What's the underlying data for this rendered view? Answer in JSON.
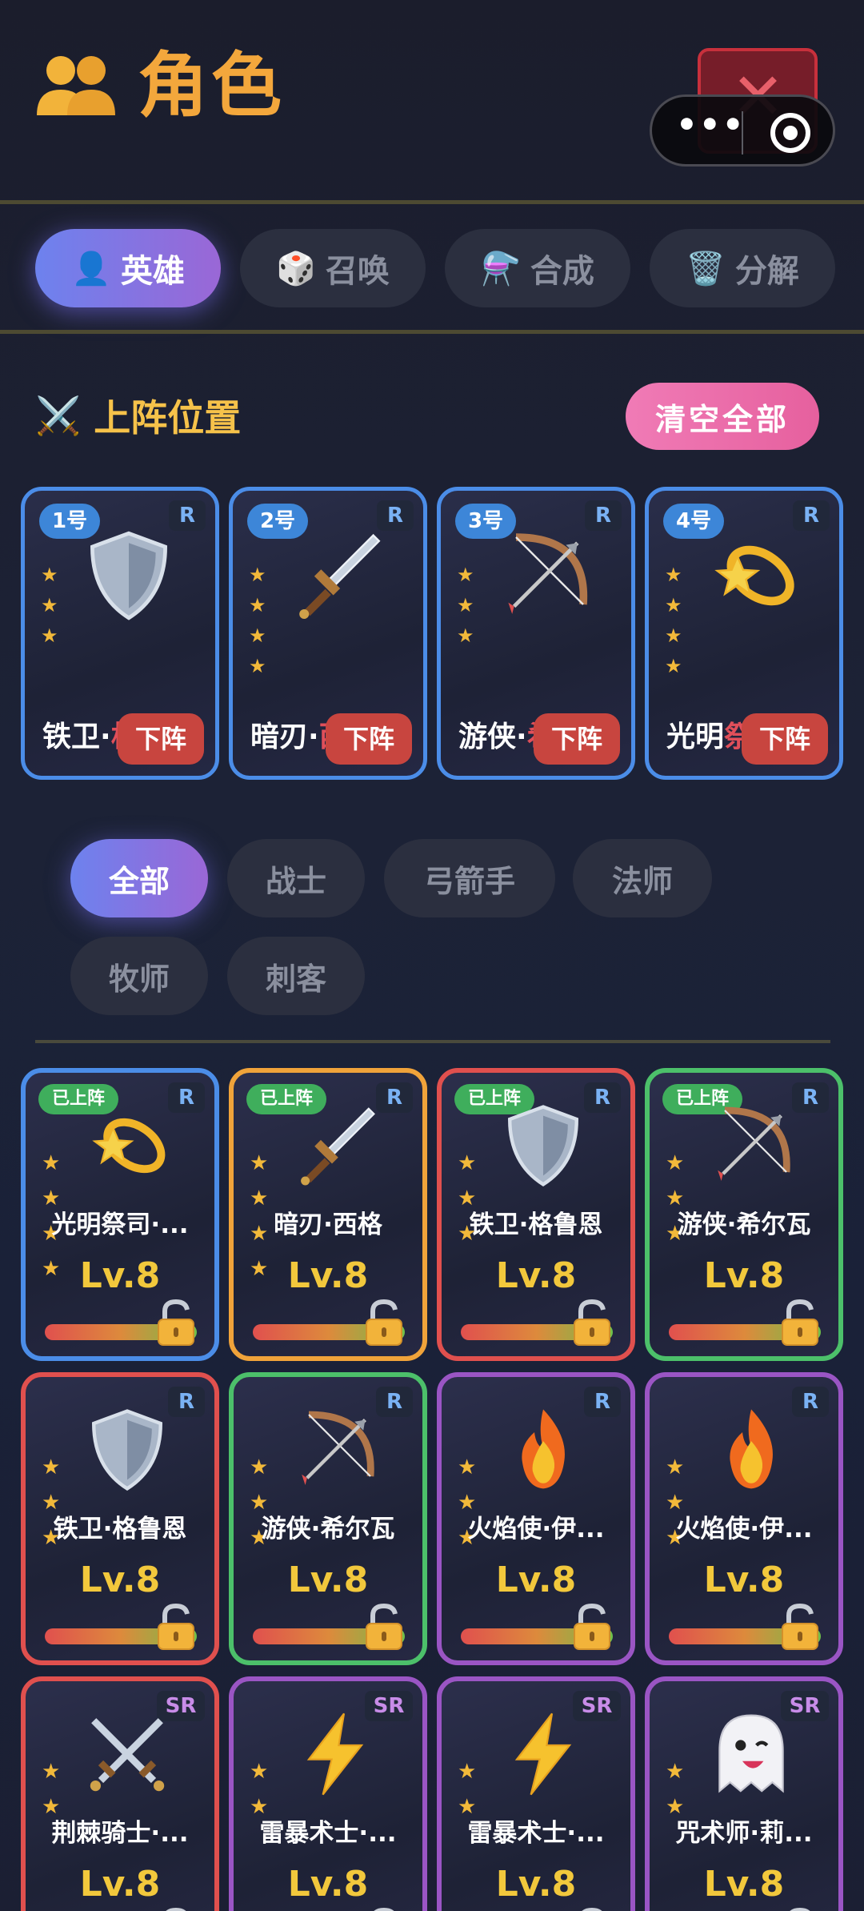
{
  "header": {
    "title": "角色",
    "title_icon": "👥"
  },
  "tabs": [
    {
      "icon": "👤",
      "label": "英雄"
    },
    {
      "icon": "🎲",
      "label": "召唤"
    },
    {
      "icon": "⚗️",
      "label": "合成"
    },
    {
      "icon": "🗑️",
      "label": "分解"
    }
  ],
  "lineup": {
    "icon": "⚔️",
    "title": "上阵位置",
    "clear_label": "清空全部",
    "slots": [
      {
        "num": "1号",
        "rarity": "R",
        "emoji": "🛡️",
        "name": "铁卫·",
        "name_fade": "格",
        "action": "下阵",
        "stars": [
          "★",
          "★",
          "★"
        ]
      },
      {
        "num": "2号",
        "rarity": "R",
        "emoji": "🗡️",
        "name": "暗刃·",
        "name_fade": "西格",
        "action": "下阵",
        "stars": [
          "★",
          "★",
          "★",
          "★"
        ]
      },
      {
        "num": "3号",
        "rarity": "R",
        "emoji": "🏹",
        "name": "游侠·",
        "name_fade": "希",
        "action": "下阵",
        "stars": [
          "★",
          "★",
          "★"
        ]
      },
      {
        "num": "4号",
        "rarity": "R",
        "emoji": "💫",
        "name": "光明",
        "name_fade": "祭司",
        "action": "下阵",
        "stars": [
          "★",
          "★",
          "★",
          "★"
        ]
      }
    ]
  },
  "filters": [
    "全部",
    "战士",
    "弓箭手",
    "法师",
    "牧师",
    "刺客"
  ],
  "heroes": [
    {
      "badge": "已上阵",
      "rarity": "R",
      "emoji": "💫",
      "name": "光明祭司·...",
      "level": "Lv.8",
      "stars": [
        "★",
        "★",
        "★",
        "★"
      ]
    },
    {
      "badge": "已上阵",
      "rarity": "R",
      "emoji": "🗡️",
      "name": "暗刃·西格",
      "level": "Lv.8",
      "stars": [
        "★",
        "★",
        "★",
        "★"
      ]
    },
    {
      "badge": "已上阵",
      "rarity": "R",
      "emoji": "🛡️",
      "name": "铁卫·格鲁恩",
      "level": "Lv.8",
      "stars": [
        "★",
        "★",
        "★"
      ]
    },
    {
      "badge": "已上阵",
      "rarity": "R",
      "emoji": "🏹",
      "name": "游侠·希尔瓦",
      "level": "Lv.8",
      "stars": [
        "★",
        "★",
        "★"
      ]
    },
    {
      "badge": "",
      "rarity": "R",
      "emoji": "🛡️",
      "name": "铁卫·格鲁恩",
      "level": "Lv.8",
      "stars": [
        "★",
        "★",
        "★"
      ]
    },
    {
      "badge": "",
      "rarity": "R",
      "emoji": "🏹",
      "name": "游侠·希尔瓦",
      "level": "Lv.8",
      "stars": [
        "★",
        "★",
        "★"
      ]
    },
    {
      "badge": "",
      "rarity": "R",
      "emoji": "🔥",
      "name": "火焰使·伊...",
      "level": "Lv.8",
      "stars": [
        "★",
        "★",
        "★"
      ]
    },
    {
      "badge": "",
      "rarity": "R",
      "emoji": "🔥",
      "name": "火焰使·伊...",
      "level": "Lv.8",
      "stars": [
        "★",
        "★",
        "★"
      ]
    },
    {
      "badge": "",
      "rarity": "SR",
      "emoji": "⚔️",
      "name": "荆棘骑士·...",
      "level": "Lv.8",
      "stars": [
        "★",
        "★"
      ]
    },
    {
      "badge": "",
      "rarity": "SR",
      "emoji": "⚡",
      "name": "雷暴术士·...",
      "level": "Lv.8",
      "stars": [
        "★",
        "★"
      ]
    },
    {
      "badge": "",
      "rarity": "SR",
      "emoji": "⚡",
      "name": "雷暴术士·...",
      "level": "Lv.8",
      "stars": [
        "★",
        "★"
      ]
    },
    {
      "badge": "",
      "rarity": "SR",
      "emoji": "👻",
      "name": "咒术师·莉...",
      "level": "Lv.8",
      "stars": [
        "★",
        "★"
      ]
    }
  ]
}
